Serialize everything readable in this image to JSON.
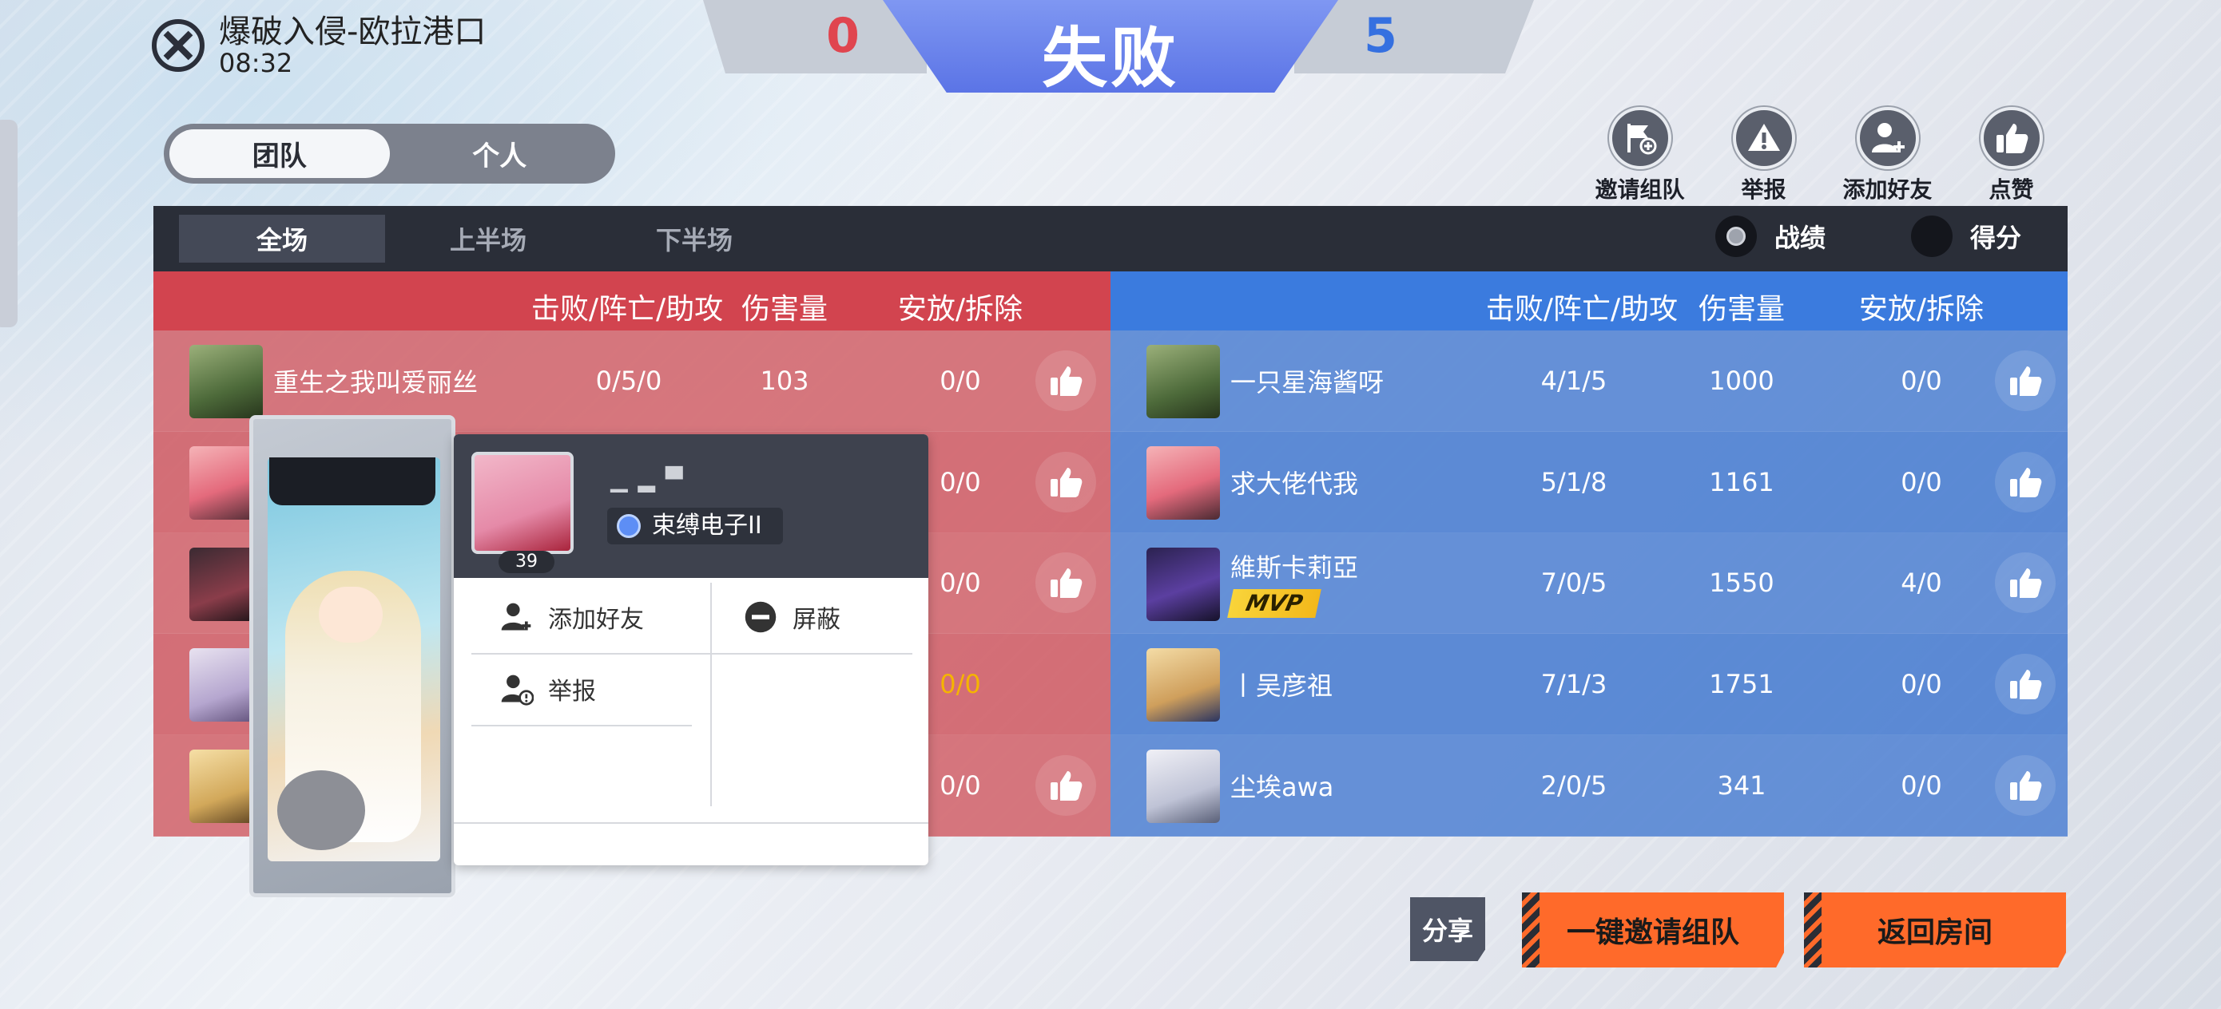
{
  "map": {
    "name": "爆破入侵-欧拉港口",
    "time": "08:32",
    "icon": "crosshair-icon"
  },
  "score": {
    "left": "0",
    "right": "5",
    "result": "失败"
  },
  "tabs": {
    "team": "团队",
    "personal": "个人"
  },
  "actions": [
    {
      "label": "邀请组队",
      "icon": "invite-team-icon"
    },
    {
      "label": "举报",
      "icon": "warning-icon"
    },
    {
      "label": "添加好友",
      "icon": "add-friend-icon"
    },
    {
      "label": "点赞",
      "icon": "thumbs-up-icon"
    }
  ],
  "periods": [
    "全场",
    "上半场",
    "下半场"
  ],
  "view_options": {
    "record": "战绩",
    "score": "得分"
  },
  "columns": {
    "kda": "击败/阵亡/助攻",
    "damage": "伤害量",
    "plant": "安放/拆除"
  },
  "red_team": [
    {
      "name": "重生之我叫爱丽丝",
      "kda": "0/5/0",
      "damage": "103",
      "plant": "0/0"
    },
    {
      "name": "",
      "kda": "",
      "damage": "",
      "plant": "0/0"
    },
    {
      "name": "",
      "kda": "",
      "damage": "",
      "plant": "0/0"
    },
    {
      "name": "",
      "kda": "",
      "damage": "",
      "plant": "0/0"
    },
    {
      "name": "",
      "kda": "",
      "damage": "",
      "plant": "0/0"
    }
  ],
  "blue_team": [
    {
      "name": "一只星海酱呀",
      "kda": "4/1/5",
      "damage": "1000",
      "plant": "0/0"
    },
    {
      "name": "求大佬代我",
      "kda": "5/1/8",
      "damage": "1161",
      "plant": "0/0"
    },
    {
      "name": "維斯卡莉亞",
      "kda": "7/0/5",
      "damage": "1550",
      "plant": "4/0",
      "badge": "MVP"
    },
    {
      "name": "丨吴彦祖",
      "kda": "7/1/3",
      "damage": "1751",
      "plant": "0/0"
    },
    {
      "name": "尘埃awa",
      "kda": "2/0/5",
      "damage": "341",
      "plant": "0/0"
    }
  ],
  "popup": {
    "level": "39",
    "rank": "束缚电子II",
    "add_friend": "添加好友",
    "block": "屏蔽",
    "report": "举报"
  },
  "buttons": {
    "share": "分享",
    "invite_all": "一键邀请组队",
    "back": "返回房间"
  },
  "colors": {
    "red": "#d2444f",
    "blue": "#3b7bde",
    "orange": "#ff6a2a",
    "lose_score": "#e0454f",
    "win_score": "#3570e0",
    "highlight": "#f5b400"
  }
}
